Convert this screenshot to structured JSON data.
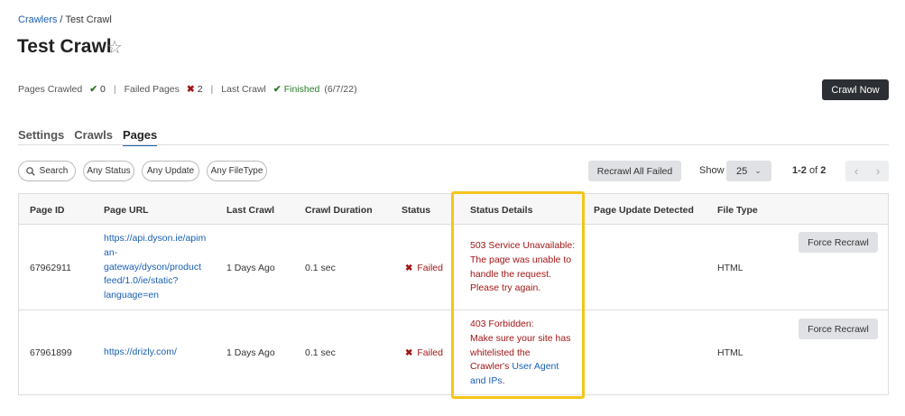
{
  "breadcrumb": {
    "parent": "Crawlers",
    "separator": "/",
    "current": "Test Crawl"
  },
  "page_title": "Test Crawl",
  "stats": {
    "pages_crawled_label": "Pages Crawled",
    "pages_crawled_value": "0",
    "failed_pages_label": "Failed Pages",
    "failed_pages_value": "2",
    "last_crawl_label": "Last Crawl",
    "last_crawl_status": "Finished",
    "last_crawl_date": "(6/7/22)",
    "divider": "|"
  },
  "crawl_now_label": "Crawl Now",
  "tabs": [
    {
      "label": "Settings",
      "active": false
    },
    {
      "label": "Crawls",
      "active": false
    },
    {
      "label": "Pages",
      "active": true
    }
  ],
  "filters": {
    "search_label": "Search",
    "status_label": "Any Status",
    "update_label": "Any Update",
    "filetype_label": "Any FileType"
  },
  "recrawl_all_label": "Recrawl All Failed",
  "show": {
    "label": "Show",
    "value": "25"
  },
  "pager": {
    "range": "1-2",
    "of": "of",
    "total": "2"
  },
  "table": {
    "columns": [
      "Page ID",
      "Page URL",
      "Last Crawl",
      "Crawl Duration",
      "Status",
      "Status Details",
      "Page Update Detected",
      "File Type"
    ],
    "rows": [
      {
        "page_id": "67962911",
        "url_lines": [
          "https://api.dyson.ie/apim",
          "an-",
          "gateway/dyson/product",
          "feed/1.0/ie/static?",
          "language=en"
        ],
        "last_crawl": "1 Days Ago",
        "duration": "0.1 sec",
        "status": "Failed",
        "details_lines": [
          "503 Service Unavailable:",
          "The page was unable to",
          "handle the request.",
          "Please try again."
        ],
        "update_detected": "",
        "file_type": "HTML",
        "action": "Force Recrawl"
      },
      {
        "page_id": "67961899",
        "url": "https://drizly.com/",
        "last_crawl": "1 Days Ago",
        "duration": "0.1 sec",
        "status": "Failed",
        "details": {
          "line1": "403 Forbidden:",
          "line2": "Make sure your site has",
          "line3": "whitelisted the",
          "line4_prefix": "Crawler's ",
          "link_part1": "User Agent",
          "link_part2": "and IPs",
          "suffix": "."
        },
        "update_detected": "",
        "file_type": "HTML",
        "action": "Force Recrawl"
      }
    ]
  },
  "colors": {
    "accent": "#1a5fb4",
    "error": "#a31515",
    "success": "#2a7a2a",
    "highlight": "#f5c518"
  }
}
